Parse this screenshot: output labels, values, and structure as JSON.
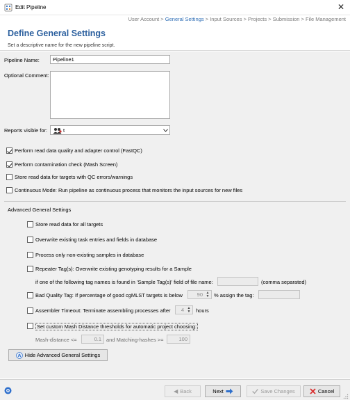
{
  "window": {
    "title": "Edit Pipeline",
    "close_glyph": "✕"
  },
  "breadcrumb": {
    "step1": "User Account",
    "sep": " > ",
    "step2": "General Settings",
    "step3": "Input Sources",
    "step4": "Projects",
    "step5": "Submission",
    "step6": "File Management",
    "current": "General Settings"
  },
  "header": {
    "title": "Define General Settings",
    "subtitle": "Set a descriptive name for the new pipeline script."
  },
  "form": {
    "pipeline_name_label": "Pipeline Name:",
    "pipeline_name_value": "Pipeline1",
    "optional_comment_label": "Optional Comment:",
    "optional_comment_value": "",
    "reports_visible_label": "Reports visible for:",
    "reports_visible_value": "t"
  },
  "checks": [
    {
      "label": "Perform read data quality and adapter control (FastQC)",
      "checked": true
    },
    {
      "label": "Perform contamination check (Mash Screen)",
      "checked": true
    },
    {
      "label": "Store read data for targets with QC errors/warnings",
      "checked": false
    },
    {
      "label": "Continuous Mode: Run pipeline as continuous process that monitors the input sources for new files",
      "checked": false
    }
  ],
  "advanced": {
    "section_title": "Advanced General Settings",
    "store_read_data": "Store read data for all targets",
    "overwrite_tasks": "Overwrite existing task entries and fields in database",
    "process_non_existing": "Process only non-existing samples in database",
    "repeater_tag": "Repeater Tag(s): Overwrite existing genotyping results for a Sample",
    "repeater_tag_detail": "if one of the following tag names is found in 'Sample Tag(s)' field of file name:",
    "repeater_tag_value": "",
    "comma_separated": "(comma separated)",
    "bad_quality_prefix": "Bad Quality Tag: If percentage of good cgMLST targets is below",
    "bad_quality_value": "90",
    "bad_quality_suffix": "% assign the tag:",
    "bad_quality_tag_value": "",
    "assembler_timeout_prefix": "Assembler Timeout: Terminate assembling processes after",
    "assembler_timeout_value": "4",
    "assembler_timeout_suffix": "hours",
    "mash_thresholds": "Set custom Mash Distance thresholds for automatic project choosing:",
    "mash_distance_label": "Mash-distance <=",
    "mash_distance_value": "0.1",
    "matching_hashes_label": "and Matching-hashes >=",
    "matching_hashes_value": "100",
    "hide_button": "Hide Advanced General Settings"
  },
  "footer": {
    "back": "Back",
    "next": "Next",
    "save_changes": "Save Changes",
    "cancel": "Cancel"
  },
  "colors": {
    "accent_blue": "#2b5f9e",
    "breadcrumb_current": "#2d6db5",
    "cancel_red": "#d92d2d",
    "next_blue": "#2e6fcc"
  }
}
